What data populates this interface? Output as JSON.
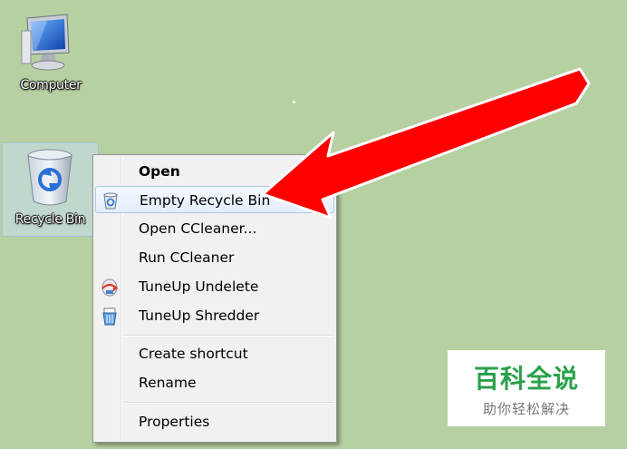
{
  "desktop": {
    "icons": [
      {
        "label": "Computer",
        "icon": "computer-icon"
      },
      {
        "label": "Recycle Bin",
        "icon": "recycle-bin-icon"
      }
    ]
  },
  "context_menu": {
    "items": [
      {
        "label": "Open",
        "bold": true,
        "icon": null
      },
      {
        "label": "Empty Recycle Bin",
        "icon": "recycle-small-icon",
        "highlighted": true
      },
      {
        "label": "Open CCleaner...",
        "icon": null
      },
      {
        "label": "Run CCleaner",
        "icon": null
      },
      {
        "label": "TuneUp Undelete",
        "icon": "tuneup-undelete-icon"
      },
      {
        "label": "TuneUp Shredder",
        "icon": "tuneup-shredder-icon"
      },
      {
        "label": "Create shortcut",
        "icon": null
      },
      {
        "label": "Rename",
        "icon": null
      },
      {
        "label": "Properties",
        "icon": null
      }
    ]
  },
  "annotation": {
    "arrow_color": "#ff0000"
  },
  "watermark": {
    "title": "百科全说",
    "subtitle": "助你轻松解决"
  },
  "colors": {
    "desktop_bg": "#b6d0a1",
    "menu_bg": "#f1f1f1",
    "highlight_border": "#a8c8ec",
    "watermark_green": "#2aa04a"
  }
}
